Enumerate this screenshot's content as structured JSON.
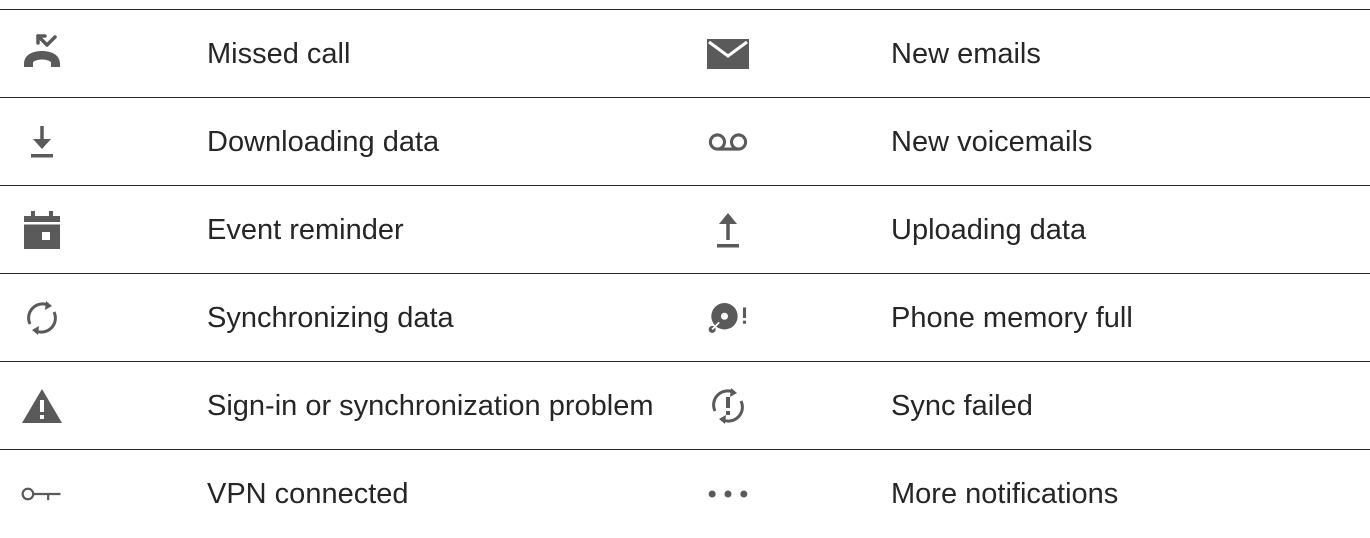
{
  "rows": [
    {
      "left": {
        "icon": "missed-call-icon",
        "label": "Missed call"
      },
      "right": {
        "icon": "email-icon",
        "label": "New emails"
      }
    },
    {
      "left": {
        "icon": "download-icon",
        "label": "Downloading data"
      },
      "right": {
        "icon": "voicemail-icon",
        "label": "New voicemails"
      }
    },
    {
      "left": {
        "icon": "calendar-icon",
        "label": "Event reminder"
      },
      "right": {
        "icon": "upload-icon",
        "label": "Uploading data"
      }
    },
    {
      "left": {
        "icon": "sync-icon",
        "label": "Synchronizing data"
      },
      "right": {
        "icon": "memory-full-icon",
        "label": "Phone memory full"
      }
    },
    {
      "left": {
        "icon": "warning-icon",
        "label": "Sign-in or synchronization problem"
      },
      "right": {
        "icon": "sync-failed-icon",
        "label": "Sync failed"
      }
    },
    {
      "left": {
        "icon": "vpn-key-icon",
        "label": "VPN connected"
      },
      "right": {
        "icon": "more-dots-icon",
        "label": "More notifications"
      }
    }
  ],
  "colors": {
    "icon": "#5a5a5a",
    "text": "#262626",
    "rule": "#2a2a2a",
    "background": "#ffffff"
  }
}
